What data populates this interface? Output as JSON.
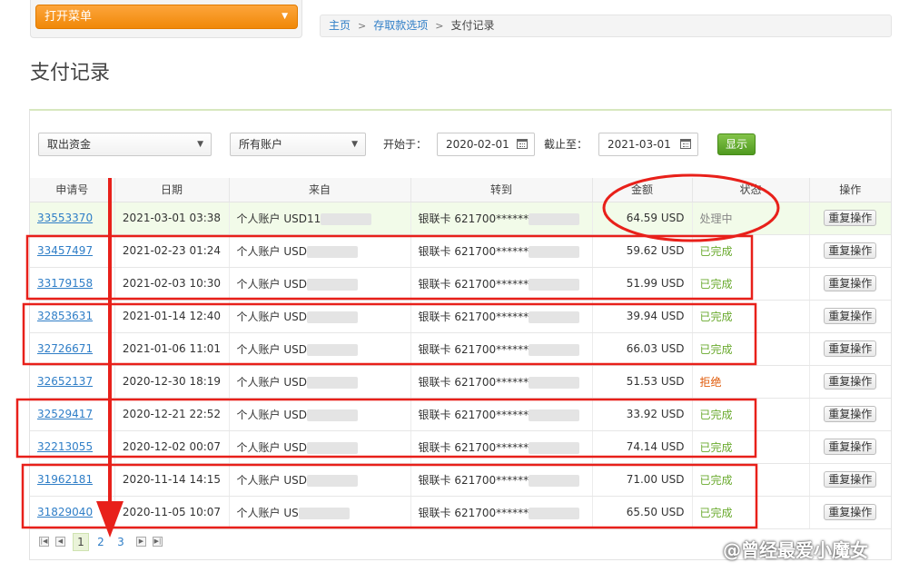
{
  "menu": {
    "label": "打开菜单"
  },
  "breadcrumb": {
    "home": "主页",
    "section": "存取款选项",
    "current": "支付记录"
  },
  "page": {
    "title": "支付记录"
  },
  "filters": {
    "type_select": "取出资金",
    "account_select": "所有账户",
    "start_label": "开始于：",
    "start_date": "2020-02-01",
    "end_label": "截止至：",
    "end_date": "2021-03-01",
    "show_button": "显示"
  },
  "table": {
    "headers": [
      "申请号",
      "日期",
      "来自",
      "转到",
      "金额",
      "状态",
      "操作"
    ],
    "op_label": "重复操作",
    "rows": [
      {
        "id": "33553370",
        "date": "2021-03-01 03:38",
        "from": "个人账户 USD11",
        "to": "银联卡 621700******",
        "amount": "64.59 USD",
        "status": "处理中",
        "status_type": "processing"
      },
      {
        "id": "33457497",
        "date": "2021-02-23 01:24",
        "from": "个人账户 USD",
        "to": "银联卡 621700******",
        "amount": "59.62 USD",
        "status": "已完成",
        "status_type": "done"
      },
      {
        "id": "33179158",
        "date": "2021-02-03 10:30",
        "from": "个人账户 USD",
        "to": "银联卡 621700******",
        "amount": "51.99 USD",
        "status": "已完成",
        "status_type": "done"
      },
      {
        "id": "32853631",
        "date": "2021-01-14 12:40",
        "from": "个人账户 USD",
        "to": "银联卡 621700******",
        "amount": "39.94 USD",
        "status": "已完成",
        "status_type": "done"
      },
      {
        "id": "32726671",
        "date": "2021-01-06 11:01",
        "from": "个人账户 USD",
        "to": "银联卡 621700******",
        "amount": "66.03 USD",
        "status": "已完成",
        "status_type": "done"
      },
      {
        "id": "32652137",
        "date": "2020-12-30 18:19",
        "from": "个人账户 USD",
        "to": "银联卡 621700******",
        "amount": "51.53 USD",
        "status": "拒绝",
        "status_type": "rejected"
      },
      {
        "id": "32529417",
        "date": "2020-12-21 22:52",
        "from": "个人账户 USD",
        "to": "银联卡 621700******",
        "amount": "33.92 USD",
        "status": "已完成",
        "status_type": "done"
      },
      {
        "id": "32213055",
        "date": "2020-12-02 00:07",
        "from": "个人账户 USD",
        "to": "银联卡 621700******",
        "amount": "74.14 USD",
        "status": "已完成",
        "status_type": "done"
      },
      {
        "id": "31962181",
        "date": "2020-11-14 14:15",
        "from": "个人账户 USD",
        "to": "银联卡 621700******",
        "amount": "71.00 USD",
        "status": "已完成",
        "status_type": "done"
      },
      {
        "id": "31829040",
        "date": "2020-11-05 10:07",
        "from": "个人账户 US",
        "to": "银联卡 621700******",
        "amount": "65.50 USD",
        "status": "已完成",
        "status_type": "done"
      }
    ]
  },
  "pagination": {
    "pages": [
      "1",
      "2",
      "3"
    ],
    "current": "1"
  },
  "watermark": {
    "text": "@曾经最爱小魔女"
  },
  "colors": {
    "accent_orange": "#f39419",
    "link": "#2f7ec7",
    "done": "#6aaa2e",
    "rejected": "#e05b0a",
    "annotation_red": "#e8201a"
  }
}
